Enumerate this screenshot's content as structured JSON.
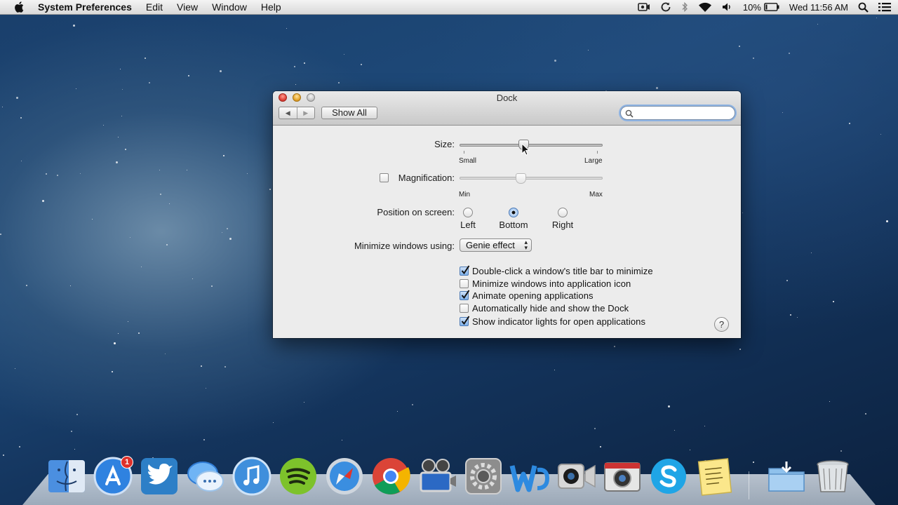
{
  "menubar": {
    "app_name": "System Preferences",
    "items": [
      "Edit",
      "View",
      "Window",
      "Help"
    ],
    "battery_percent": "10%",
    "clock": "Wed 11:56 AM"
  },
  "window": {
    "title": "Dock",
    "toolbar": {
      "back_label": "◀",
      "forward_label": "▶",
      "show_all_label": "Show All",
      "search_placeholder": ""
    },
    "size": {
      "label": "Size:",
      "min_label": "Small",
      "max_label": "Large",
      "value": 0.45
    },
    "magnification": {
      "label": "Magnification:",
      "checked": false,
      "min_label": "Min",
      "max_label": "Max",
      "value": 0.43
    },
    "position": {
      "label": "Position on screen:",
      "options": [
        "Left",
        "Bottom",
        "Right"
      ],
      "selected": "Bottom"
    },
    "minimize": {
      "label": "Minimize windows using:",
      "value": "Genie effect"
    },
    "options": [
      {
        "label": "Double-click a window's title bar to minimize",
        "checked": true
      },
      {
        "label": "Minimize windows into application icon",
        "checked": false
      },
      {
        "label": "Animate opening applications",
        "checked": true
      },
      {
        "label": "Automatically hide and show the Dock",
        "checked": false
      },
      {
        "label": "Show indicator lights for open applications",
        "checked": true
      }
    ],
    "help_label": "?"
  },
  "dock": {
    "app_store_badge": "1",
    "apps": [
      "finder",
      "app-store",
      "twitter",
      "messages",
      "itunes",
      "spotify",
      "safari",
      "chrome",
      "imovie",
      "system-preferences",
      "word",
      "facetime",
      "photo-booth",
      "skype",
      "stickies",
      "downloads-folder",
      "trash"
    ]
  }
}
